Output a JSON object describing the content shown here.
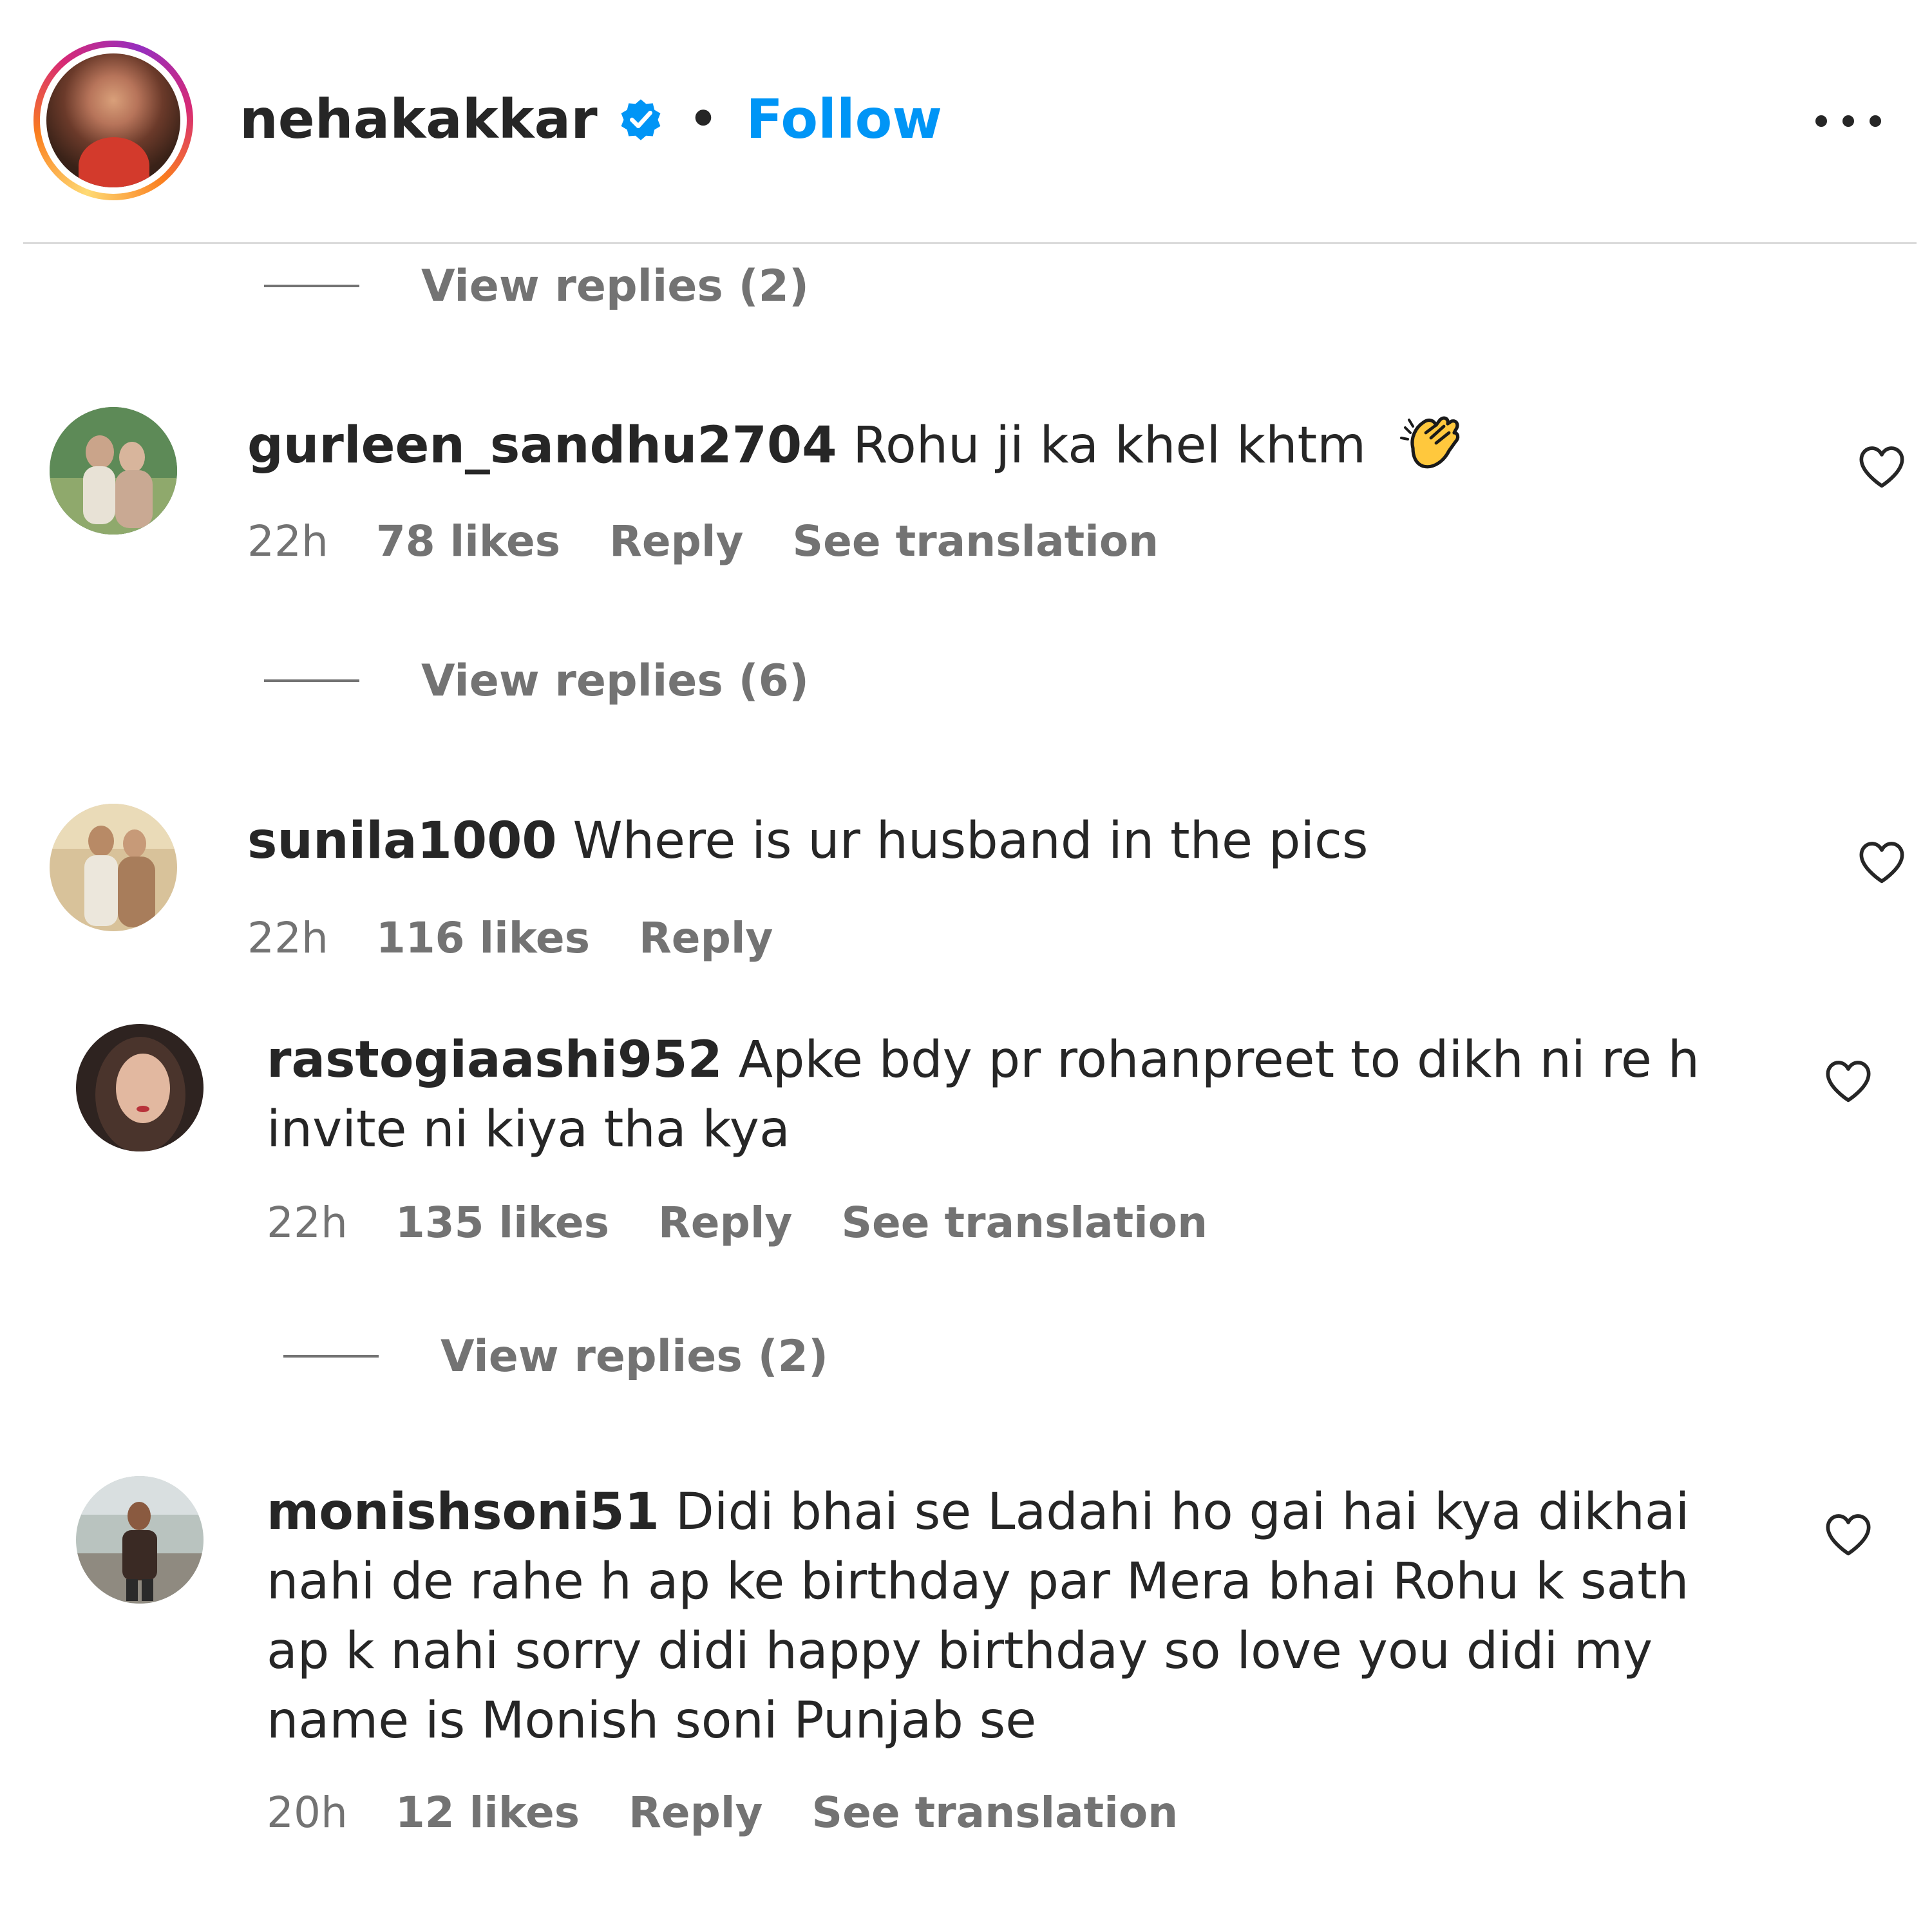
{
  "header": {
    "username": "nehakakkar",
    "separator": "•",
    "follow_label": "Follow"
  },
  "colors": {
    "follow_blue": "#0095f6",
    "verified_blue": "#0095f6",
    "muted_text": "#737373",
    "primary_text": "#262626",
    "divider": "#dbdbdb"
  },
  "icons": {
    "header_verified": "verified-badge-icon",
    "more": "more-options-icon",
    "like": "heart-outline-icon",
    "emoji": "clapping-hands-emoji"
  },
  "thread": [
    {
      "view_replies": "View replies (2)"
    },
    {
      "username": "gurleen_sandhu2704",
      "text": "Rohu ji ka khel khtm",
      "time": "22h",
      "likes": "78 likes",
      "reply": "Reply",
      "translation": "See translation"
    },
    {
      "view_replies": "View replies (6)"
    },
    {
      "username": "sunila1000",
      "text": "Where is ur husband in the pics",
      "time": "22h",
      "likes": "116 likes",
      "reply": "Reply"
    },
    {
      "username": "rastogiaashi952",
      "text": "Apke bdy pr rohanpreet to dikh ni re h invite ni kiya tha kya",
      "time": "22h",
      "likes": "135 likes",
      "reply": "Reply",
      "translation": "See translation"
    },
    {
      "view_replies": "View replies (2)"
    },
    {
      "username": "monishsoni51",
      "text": "Didi bhai se Ladahi ho gai hai kya dikhai nahi de rahe h ap ke birthday par Mera bhai Rohu k sath ap k nahi sorry didi happy birthday so love you didi my name is Monish soni Punjab se",
      "time": "20h",
      "likes": "12 likes",
      "reply": "Reply",
      "translation": "See translation"
    }
  ]
}
